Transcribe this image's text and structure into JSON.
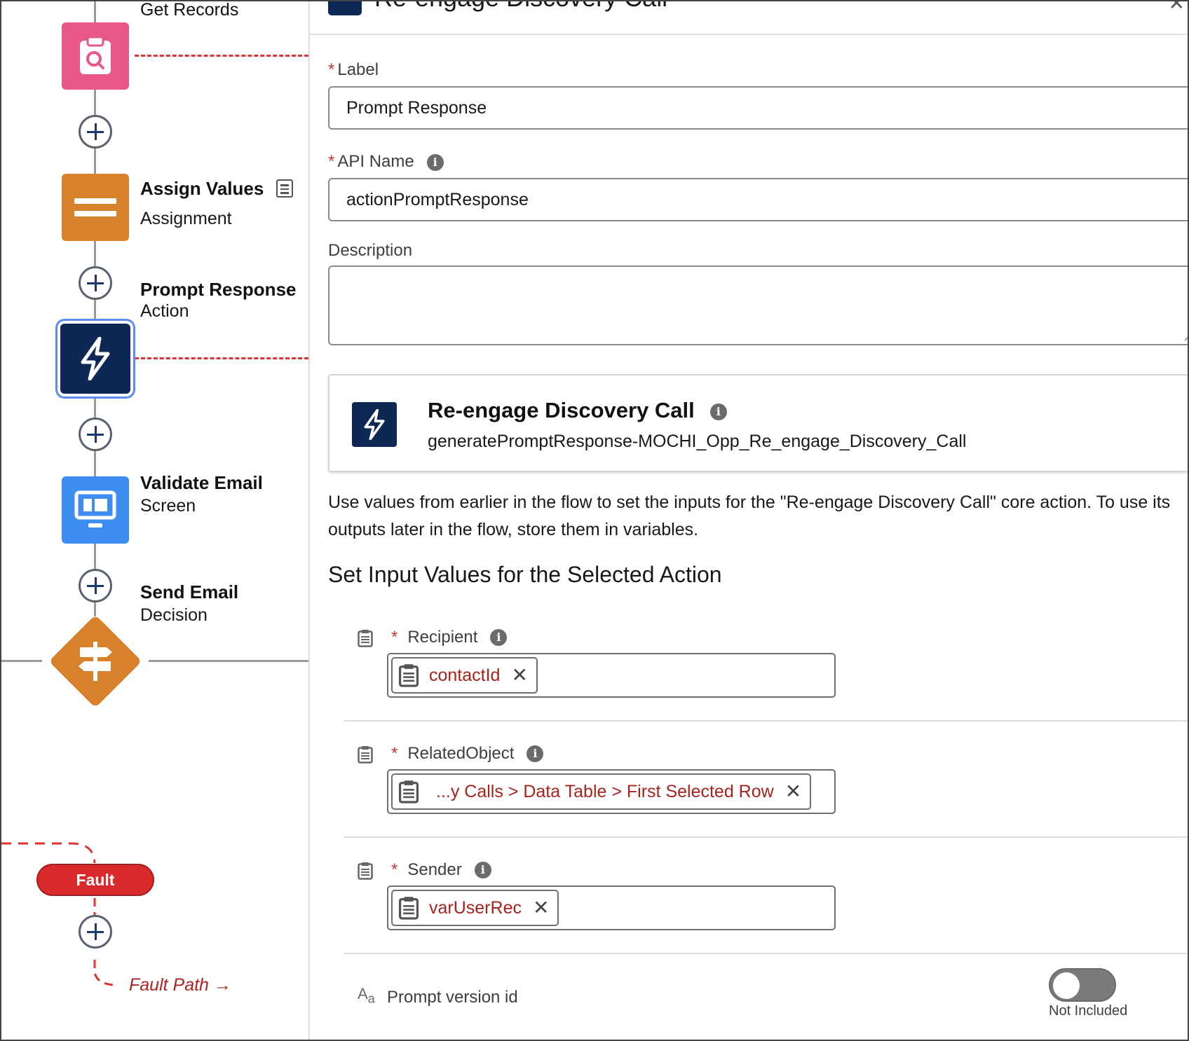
{
  "canvas": {
    "nodes": [
      {
        "title": "Get Records",
        "subtitle": "",
        "icon": "clipboard-search-icon",
        "color": "#e8578a"
      },
      {
        "title": "Assign Values",
        "subtitle": "Assignment",
        "icon": "equals-icon",
        "color": "#d7812c"
      },
      {
        "title": "Prompt Response",
        "subtitle": "Action",
        "icon": "lightning-icon",
        "color": "#0e2856"
      },
      {
        "title": "Validate Email",
        "subtitle": "Screen",
        "icon": "monitor-icon",
        "color": "#3d8ef0"
      },
      {
        "title": "Send Email",
        "subtitle": "Decision",
        "icon": "signpost-icon",
        "color": "#d7812c"
      }
    ],
    "fault_label": "Fault",
    "fault_path_label": "Fault Path →"
  },
  "panel": {
    "header_title": "Re-engage Discovery Call",
    "label_field": {
      "label": "Label",
      "value": "Prompt Response"
    },
    "api_name_field": {
      "label": "API Name",
      "value": "actionPromptResponse"
    },
    "description_field": {
      "label": "Description",
      "value": ""
    },
    "action_card": {
      "title": "Re-engage Discovery Call",
      "api_name": "generatePromptResponse-MOCHI_Opp_Re_engage_Discovery_Call"
    },
    "description_text": "Use values from earlier in the flow to set the inputs for the \"Re-engage Discovery Call\" core action. To use its outputs later in the flow, store them in variables.",
    "section_title": "Set Input Values for the Selected Action",
    "inputs": [
      {
        "label": "Recipient",
        "value": "contactId"
      },
      {
        "label": "RelatedObject",
        "value": "...y Calls > Data Table > First Selected Row"
      },
      {
        "label": "Sender",
        "value": "varUserRec"
      }
    ],
    "prompt_version": {
      "label": "Prompt version id",
      "toggle_state": "Not Included",
      "icon_text": "A",
      "icon_sub": "a"
    }
  },
  "colors": {
    "required": "#c23934",
    "resource_text": "#a8231d",
    "fault": "#d92b2b",
    "selection_ring": "#5a8dee"
  }
}
